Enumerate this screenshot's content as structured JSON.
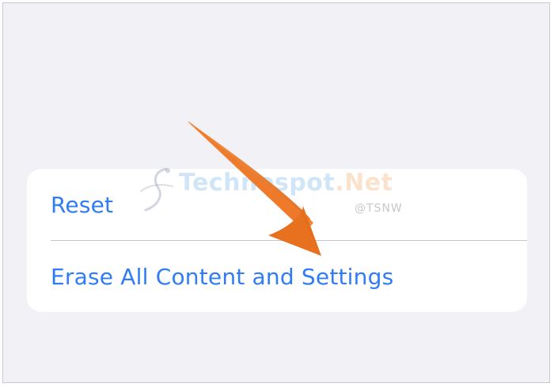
{
  "settings_group": {
    "rows": [
      {
        "label": "Reset"
      },
      {
        "label": "Erase All Content and Settings"
      }
    ]
  },
  "watermark": {
    "brand_main": "Technospot",
    "brand_tld": ".Net",
    "handle": "@TSNW"
  },
  "colors": {
    "background": "#f1f1f6",
    "row_label": "#2f7cf6",
    "arrow": "#ee7a2a",
    "divider": "#c6c6c8"
  },
  "annotation": {
    "icon": "arrow-pointer-icon"
  }
}
